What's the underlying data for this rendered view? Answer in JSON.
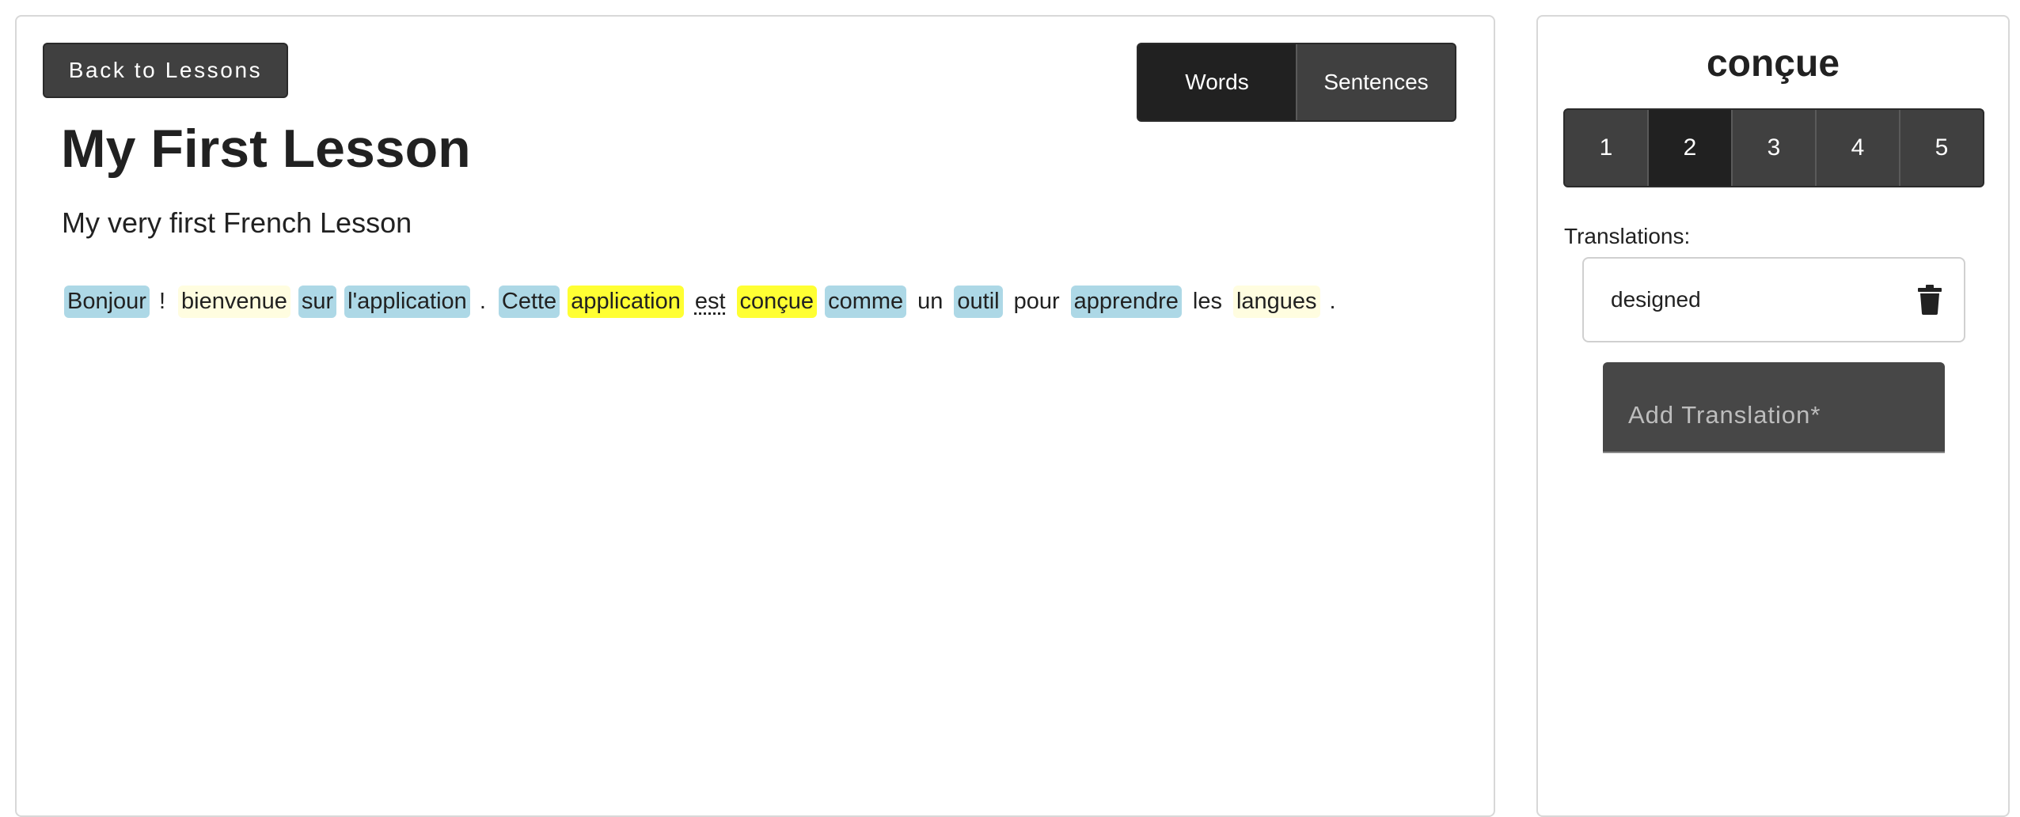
{
  "main": {
    "back_button_label": "Back to Lessons",
    "mode_toggle": {
      "options": [
        "Words",
        "Sentences"
      ],
      "selected": "Words"
    },
    "lesson_title": "My First Lesson",
    "lesson_description": "My very first French Lesson",
    "tokens": [
      {
        "text": "Bonjour",
        "status": "known"
      },
      {
        "text": "!",
        "status": "punct"
      },
      {
        "text": "bienvenue",
        "status": "learning"
      },
      {
        "text": "sur",
        "status": "known"
      },
      {
        "text": "l'application",
        "status": "known"
      },
      {
        "text": ".",
        "status": "punct"
      },
      {
        "text": "Cette",
        "status": "known"
      },
      {
        "text": "application",
        "status": "selected"
      },
      {
        "text": "est",
        "status": "est"
      },
      {
        "text": "conçue",
        "status": "selected"
      },
      {
        "text": "comme",
        "status": "known"
      },
      {
        "text": "un",
        "status": "unknown"
      },
      {
        "text": "outil",
        "status": "known"
      },
      {
        "text": "pour",
        "status": "unknown"
      },
      {
        "text": "apprendre",
        "status": "known"
      },
      {
        "text": "les",
        "status": "unknown"
      },
      {
        "text": "langues",
        "status": "learning"
      },
      {
        "text": ".",
        "status": "punct"
      }
    ]
  },
  "sidebar": {
    "selected_word": "conçue",
    "levels": [
      "1",
      "2",
      "3",
      "4",
      "5"
    ],
    "selected_level": "2",
    "translations_label": "Translations:",
    "translations": [
      "designed"
    ],
    "add_translation_placeholder": "Add Translation*"
  },
  "colors": {
    "known_word": "#add8e6",
    "learning_word": "#fffde0",
    "selected_word": "#ffff33",
    "button_dark": "#404040",
    "button_active": "#212121"
  },
  "icons": {
    "delete": "trash-icon"
  }
}
